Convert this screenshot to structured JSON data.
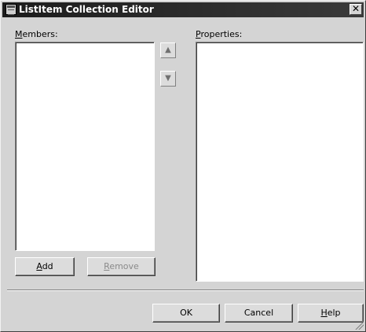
{
  "window": {
    "title": "ListItem Collection Editor",
    "close_glyph": "✕"
  },
  "members": {
    "label_accel": "M",
    "label_rest": "embers:",
    "items": []
  },
  "properties": {
    "label_accel": "P",
    "label_rest": "roperties:"
  },
  "reorder": {
    "up_glyph": "▲",
    "down_glyph": "▼"
  },
  "buttons": {
    "add_accel": "A",
    "add_rest": "dd",
    "remove_accel": "R",
    "remove_rest": "emove",
    "ok": "OK",
    "cancel": "Cancel",
    "help_accel": "H",
    "help_rest": "elp"
  },
  "icons": {
    "app": "collection-editor-icon",
    "close": "close-icon",
    "up": "arrow-up-icon",
    "down": "arrow-down-icon",
    "grip": "resize-grip-icon"
  }
}
